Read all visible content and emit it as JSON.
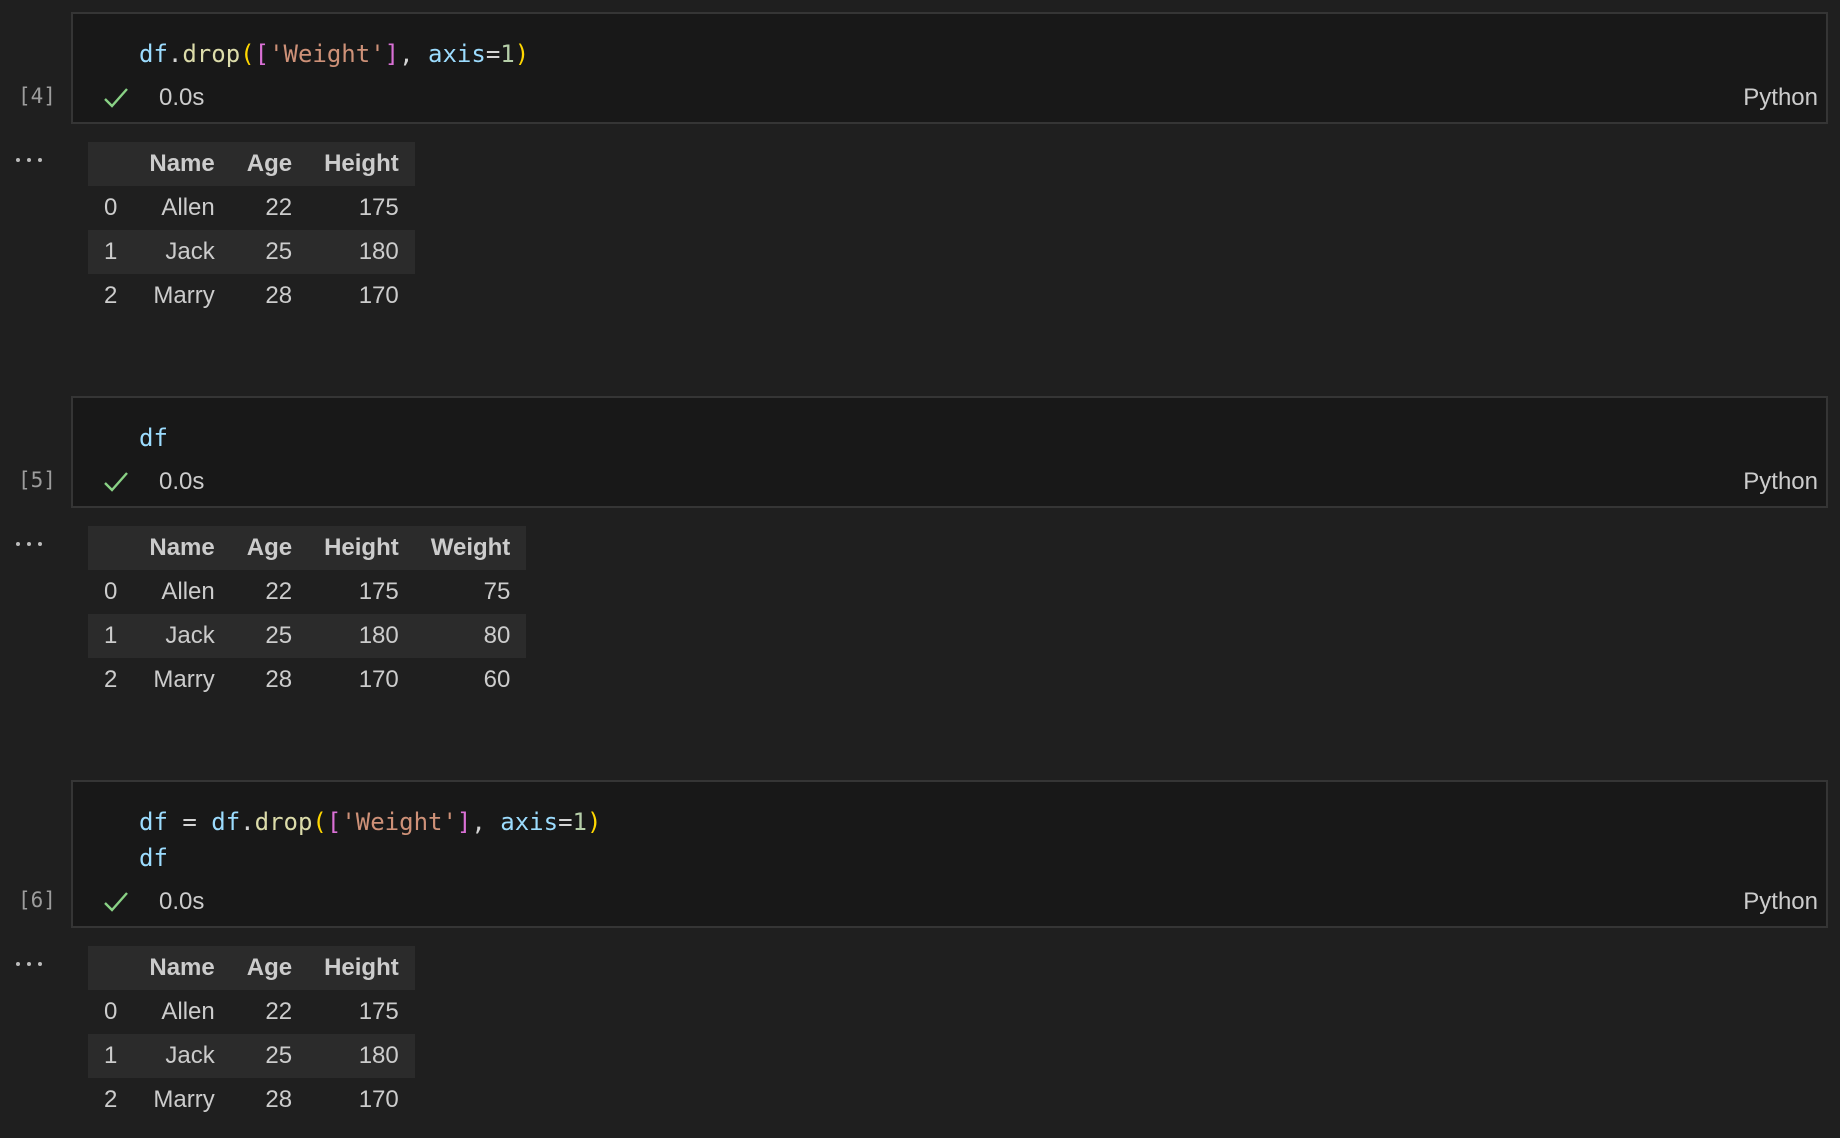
{
  "colors": {
    "background": "#1f1f1f",
    "editor_bg": "#181818",
    "editor_border": "#353535",
    "check": "#89d185",
    "stripe": "#2b2b2b"
  },
  "cells": [
    {
      "exec_count": "[4]",
      "exec_time": "0.0s",
      "language": "Python",
      "code": [
        [
          {
            "t": "df",
            "c": "var"
          },
          {
            "t": ".",
            "c": "op"
          },
          {
            "t": "drop",
            "c": "fn"
          },
          {
            "t": "(",
            "c": "br1"
          },
          {
            "t": "[",
            "c": "br2"
          },
          {
            "t": "'Weight'",
            "c": "str"
          },
          {
            "t": "]",
            "c": "br2"
          },
          {
            "t": ", ",
            "c": "op"
          },
          {
            "t": "axis",
            "c": "var"
          },
          {
            "t": "=",
            "c": "op"
          },
          {
            "t": "1",
            "c": "num"
          },
          {
            "t": ")",
            "c": "br1"
          }
        ]
      ],
      "output": {
        "columns": [
          "",
          "Name",
          "Age",
          "Height"
        ],
        "rows": [
          [
            "0",
            "Allen",
            "22",
            "175"
          ],
          [
            "1",
            "Jack",
            "25",
            "180"
          ],
          [
            "2",
            "Marry",
            "28",
            "170"
          ]
        ]
      }
    },
    {
      "exec_count": "[5]",
      "exec_time": "0.0s",
      "language": "Python",
      "code": [
        [
          {
            "t": "df",
            "c": "var"
          }
        ]
      ],
      "output": {
        "columns": [
          "",
          "Name",
          "Age",
          "Height",
          "Weight"
        ],
        "rows": [
          [
            "0",
            "Allen",
            "22",
            "175",
            "75"
          ],
          [
            "1",
            "Jack",
            "25",
            "180",
            "80"
          ],
          [
            "2",
            "Marry",
            "28",
            "170",
            "60"
          ]
        ]
      }
    },
    {
      "exec_count": "[6]",
      "exec_time": "0.0s",
      "language": "Python",
      "code": [
        [
          {
            "t": "df",
            "c": "var"
          },
          {
            "t": " = ",
            "c": "op"
          },
          {
            "t": "df",
            "c": "var"
          },
          {
            "t": ".",
            "c": "op"
          },
          {
            "t": "drop",
            "c": "fn"
          },
          {
            "t": "(",
            "c": "br1"
          },
          {
            "t": "[",
            "c": "br2"
          },
          {
            "t": "'Weight'",
            "c": "str"
          },
          {
            "t": "]",
            "c": "br2"
          },
          {
            "t": ", ",
            "c": "op"
          },
          {
            "t": "axis",
            "c": "var"
          },
          {
            "t": "=",
            "c": "op"
          },
          {
            "t": "1",
            "c": "num"
          },
          {
            "t": ")",
            "c": "br1"
          }
        ],
        [
          {
            "t": "df",
            "c": "var"
          }
        ]
      ],
      "output": {
        "columns": [
          "",
          "Name",
          "Age",
          "Height"
        ],
        "rows": [
          [
            "0",
            "Allen",
            "22",
            "175"
          ],
          [
            "1",
            "Jack",
            "25",
            "180"
          ],
          [
            "2",
            "Marry",
            "28",
            "170"
          ]
        ]
      }
    }
  ]
}
